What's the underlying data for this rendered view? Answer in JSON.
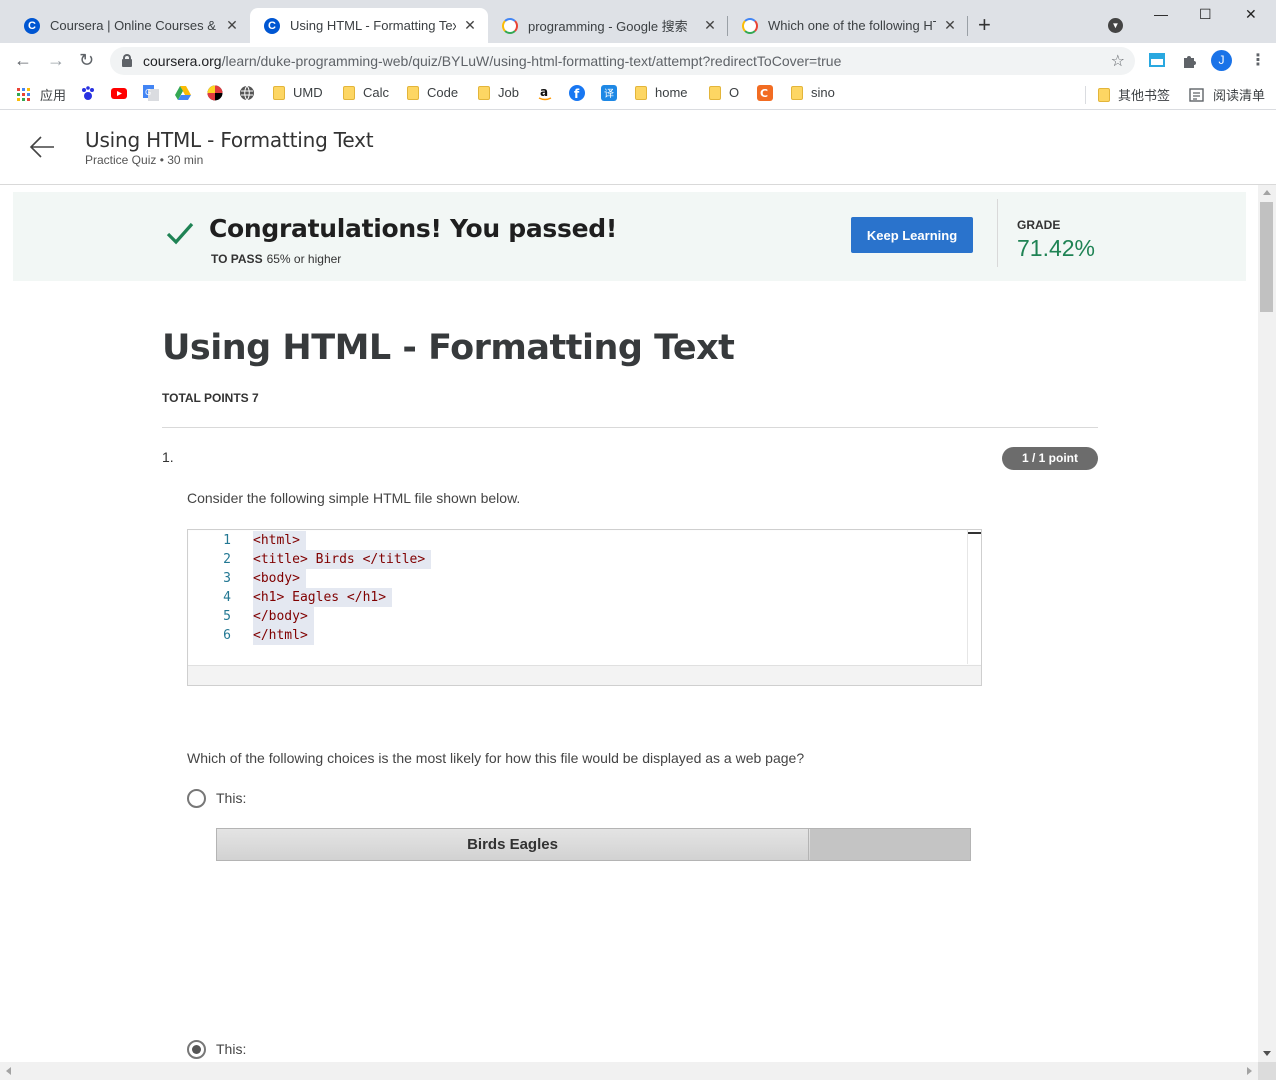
{
  "browser": {
    "tabs": [
      {
        "title": "Coursera | Online Courses & C",
        "favicon": "coursera-icon",
        "active": false
      },
      {
        "title": "Using HTML - Formatting Text",
        "favicon": "coursera-icon",
        "active": true
      },
      {
        "title": "programming - Google 搜索",
        "favicon": "google-icon",
        "active": false
      },
      {
        "title": "Which one of the following HT",
        "favicon": "google-icon",
        "active": false
      }
    ],
    "url_host": "coursera.org",
    "url_path": "/learn/duke-programming-web/quiz/BYLuW/using-html-formatting-text/attempt?redirectToCover=true",
    "profile_initial": "J",
    "bookmarks": [
      {
        "label": "应用",
        "icon": "apps-grid-icon"
      },
      {
        "label": "",
        "icon": "baidu-paw-icon"
      },
      {
        "label": "",
        "icon": "youtube-icon"
      },
      {
        "label": "",
        "icon": "google-translate-icon"
      },
      {
        "label": "",
        "icon": "google-drive-icon"
      },
      {
        "label": "",
        "icon": "maryland-flag-icon"
      },
      {
        "label": "",
        "icon": "globe-icon"
      },
      {
        "label": "UMD",
        "icon": "folder-icon"
      },
      {
        "label": "Calc",
        "icon": "folder-icon"
      },
      {
        "label": "Code",
        "icon": "folder-icon"
      },
      {
        "label": "Job",
        "icon": "folder-icon"
      },
      {
        "label": "",
        "icon": "amazon-icon"
      },
      {
        "label": "",
        "icon": "facebook-icon"
      },
      {
        "label": "",
        "icon": "translate-app-icon"
      },
      {
        "label": "home",
        "icon": "folder-icon"
      },
      {
        "label": "O",
        "icon": "folder-icon"
      },
      {
        "label": "",
        "icon": "c-orange-icon"
      },
      {
        "label": "sino",
        "icon": "folder-icon"
      }
    ],
    "other_bookmarks": "其他书签",
    "reading_list": "阅读清单"
  },
  "header": {
    "title": "Using HTML - Formatting Text",
    "subtitle": "Practice Quiz • 30 min"
  },
  "banner": {
    "message": "Congratulations! You passed!",
    "to_pass_label": "TO PASS",
    "to_pass_value": "65% or higher",
    "button_label": "Keep Learning",
    "grade_label": "GRADE",
    "grade_value": "71.42%",
    "grade_color": "#1f8354",
    "button_color": "#2a73cc"
  },
  "quiz": {
    "title": "Using HTML - Formatting Text",
    "total_points": "TOTAL POINTS 7",
    "question_number": "1.",
    "points_badge": "1 / 1 point",
    "prompt": "Consider the following simple HTML file shown below.",
    "code_lines": [
      {
        "n": "1",
        "text": "<html>"
      },
      {
        "n": "2",
        "text": "<title> Birds </title>"
      },
      {
        "n": "3",
        "text": "<body>"
      },
      {
        "n": "4",
        "text": "<h1> Eagles </h1>"
      },
      {
        "n": "5",
        "text": "</body>"
      },
      {
        "n": "6",
        "text": "</html>"
      }
    ],
    "question": "Which of the following choices is the most likely for how this file would be displayed as a web page?",
    "options": [
      {
        "label": "This:",
        "selected": false,
        "preview_text": "Birds Eagles"
      },
      {
        "label": "This:",
        "selected": true
      }
    ]
  }
}
